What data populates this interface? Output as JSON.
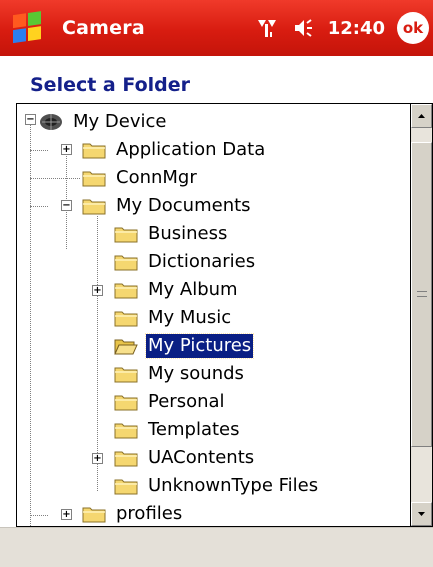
{
  "titlebar": {
    "app_title": "Camera",
    "time": "12:40",
    "ok_label": "ok",
    "icons": [
      "windows-start-icon",
      "signal-icon",
      "volume-icon"
    ]
  },
  "dialog": {
    "heading": "Select a Folder"
  },
  "tree": {
    "items": [
      {
        "label": "My Device",
        "icon": "device-icon",
        "expander": "minus"
      },
      {
        "label": "Application Data",
        "icon": "folder-icon",
        "expander": "plus"
      },
      {
        "label": "ConnMgr",
        "icon": "folder-icon",
        "expander": "none"
      },
      {
        "label": "My Documents",
        "icon": "folder-icon",
        "expander": "minus"
      },
      {
        "label": "Business",
        "icon": "folder-icon",
        "expander": "none"
      },
      {
        "label": "Dictionaries",
        "icon": "folder-icon",
        "expander": "none"
      },
      {
        "label": "My Album",
        "icon": "folder-icon",
        "expander": "plus"
      },
      {
        "label": "My Music",
        "icon": "folder-icon",
        "expander": "none"
      },
      {
        "label": "My Pictures",
        "icon": "open-folder-icon",
        "expander": "none",
        "selected": true
      },
      {
        "label": "My sounds",
        "icon": "folder-icon",
        "expander": "none"
      },
      {
        "label": "Personal",
        "icon": "folder-icon",
        "expander": "none"
      },
      {
        "label": "Templates",
        "icon": "folder-icon",
        "expander": "none"
      },
      {
        "label": "UAContents",
        "icon": "folder-icon",
        "expander": "plus"
      },
      {
        "label": "UnknownType Files",
        "icon": "folder-icon",
        "expander": "none"
      },
      {
        "label": "profiles",
        "icon": "folder-icon",
        "expander": "plus"
      }
    ]
  },
  "colors": {
    "titlebar": "#d81c10",
    "heading": "#14208a",
    "selection": "#0a1f84",
    "folder": "#f5d770"
  }
}
